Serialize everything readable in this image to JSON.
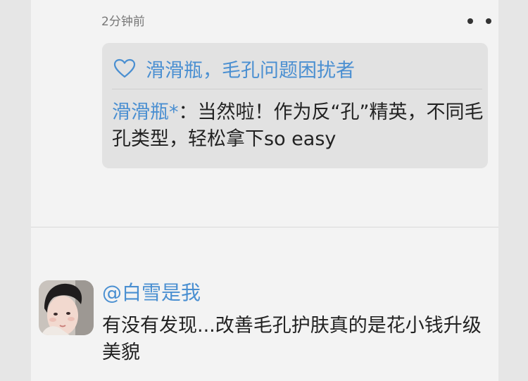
{
  "post": {
    "timestamp": "2分钟前",
    "more_icon": "more-dots-icon"
  },
  "quote": {
    "heart_icon": "heart-outline-icon",
    "liked_by": "滑滑瓶，毛孔问题困扰者",
    "reply_author": "滑滑瓶*",
    "reply_body": "：当然啦！作为反“孔”精英，不同毛孔类型，轻松拿下so easy"
  },
  "comment": {
    "author": "@白雪是我",
    "text": "有没有发现...改善毛孔护肤真的是花小钱升级美貌"
  },
  "colors": {
    "link": "#4a8fd1",
    "card_bg": "#e2e2e2",
    "page_bg": "#f3f3f3"
  }
}
